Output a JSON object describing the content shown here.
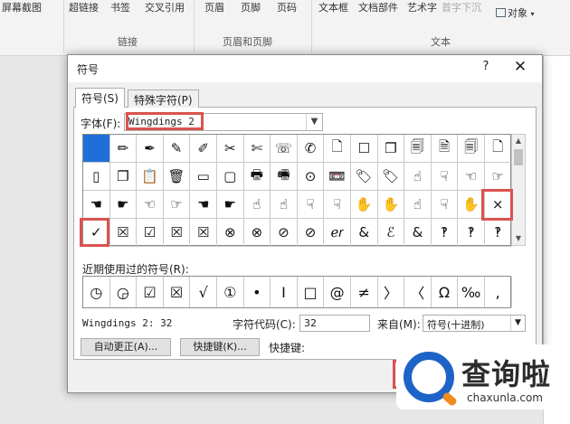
{
  "ribbon": {
    "buttons": [
      "屏幕截图",
      "超链接",
      "书签",
      "交叉引用",
      "页眉",
      "页脚",
      "页码",
      "文本框",
      "文档部件",
      "艺术字",
      "首字下沉",
      "对象"
    ],
    "groups": [
      "链接",
      "页眉和页脚",
      "文本"
    ]
  },
  "dialog": {
    "title": "符号",
    "help": "?",
    "close": "✕",
    "tabs": [
      "符号(S)",
      "特殊字符(P)"
    ],
    "font_label": "字体(F):",
    "font_value": "Wingdings 2",
    "grid_rows": [
      [
        "",
        "✏",
        "✒",
        "✎",
        "✐",
        "✂",
        "✄",
        "☏",
        "✆",
        "🗋",
        "☐",
        "❐",
        "🗐",
        "🗎",
        "🗐",
        "🗋"
      ],
      [
        "▯",
        "❐",
        "📋",
        "🗑",
        "▭",
        "▢",
        "🖶",
        "🖷",
        "⊙",
        "📼",
        "🏷",
        "🏷",
        "☝",
        "☟",
        "☜",
        "☞"
      ],
      [
        "☚",
        "☛",
        "☜",
        "☞",
        "☚",
        "☛",
        "☝",
        "☝",
        "☟",
        "☟",
        "✋",
        "✋",
        "☝",
        "☟",
        "✋",
        "×"
      ],
      [
        "✓",
        "☒",
        "☑",
        "☒",
        "☒",
        "⊗",
        "⊗",
        "⊘",
        "⊘",
        "ℯ𝑟",
        "&",
        "ℰ",
        "&",
        "‽",
        "‽",
        "‽"
      ]
    ],
    "recent_label": "近期使用过的符号(R):",
    "recent": [
      "◷",
      "◶",
      "☑",
      "☒",
      "√",
      "①",
      "•",
      "I",
      "□",
      "@",
      "≠",
      "〉",
      "〈",
      "Ω",
      "‰",
      ","
    ],
    "font_info": "Wingdings 2: 32",
    "code_label": "字符代码(C):",
    "code_value": "32",
    "from_label": "来自(M):",
    "from_value": "符号(十进制)",
    "autocorrect_button": "自动更正(A)...",
    "shortcut_button": "快捷键(K)...",
    "shortcut_label": "快捷键:"
  },
  "watermark": {
    "name": "查询啦",
    "domain": "chaxunla.com"
  }
}
